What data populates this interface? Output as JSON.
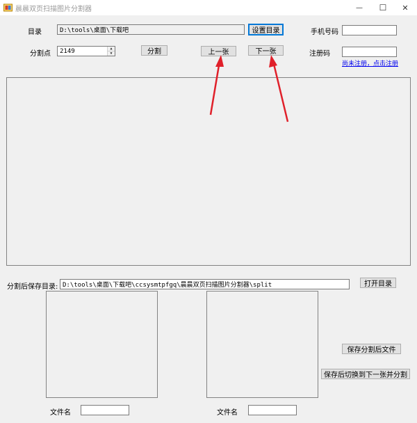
{
  "window": {
    "title": "晨晨双页扫描图片分割器",
    "minimize_glyph": "—",
    "maximize_glyph": "☐",
    "close_glyph": "✕"
  },
  "top": {
    "dir_label": "目录",
    "dir_value": "D:\\tools\\桌面\\下载吧",
    "set_dir_button": "设置目录",
    "phone_label": "手机号码",
    "phone_value": "",
    "split_point_label": "分割点",
    "split_point_value": "2149",
    "split_button": "分割",
    "prev_button": "上一张",
    "next_button": "下一张",
    "reg_code_label": "注册码",
    "reg_code_value": "",
    "register_link": "尚未注册，点击注册"
  },
  "bottom": {
    "save_dir_label": "分割后保存目录:",
    "save_dir_value": "D:\\tools\\桌面\\下载吧\\ccsysmtpfgq\\晨晨双页扫描图片分割器\\split",
    "open_dir_button": "打开目录",
    "save_split_button": "保存分割后文件",
    "save_next_button": "保存后切换到下一张并分割",
    "left_filename_label": "文件名",
    "left_filename_value": "",
    "right_filename_label": "文件名",
    "right_filename_value": ""
  },
  "annotation": {
    "arrow_color": "#e0202a"
  },
  "icons": {
    "app": "app-icon",
    "spin_up": "▲",
    "spin_down": "▼"
  }
}
